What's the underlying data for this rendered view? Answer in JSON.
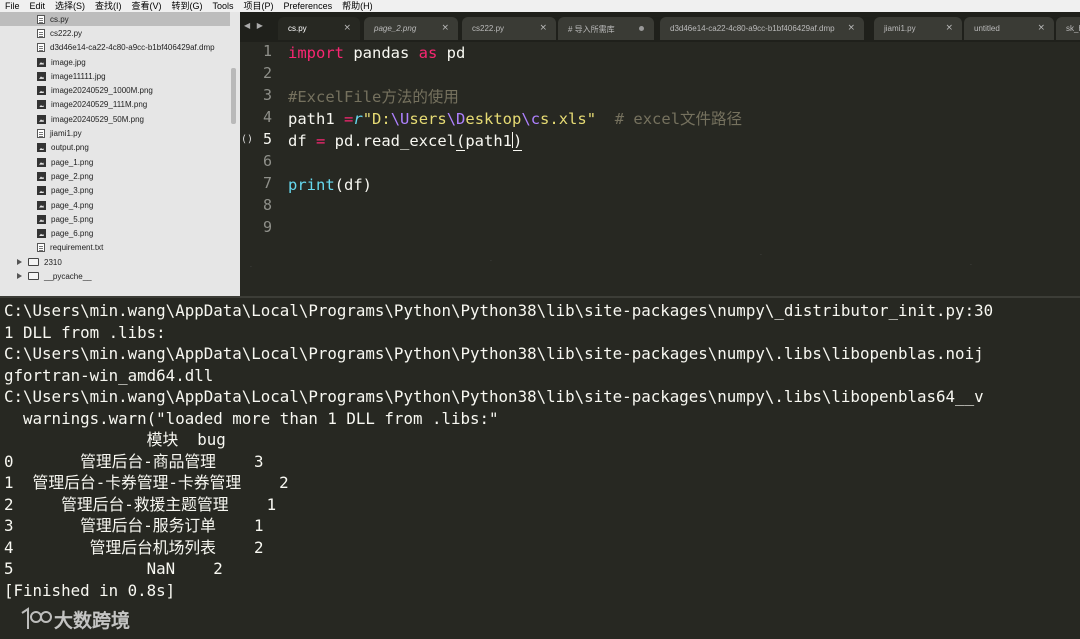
{
  "menubar": {
    "items": [
      "File",
      "Edit",
      "选择(S)",
      "查找(I)",
      "查看(V)",
      "转到(G)",
      "Tools",
      "项目(P)",
      "Preferences",
      "帮助(H)"
    ]
  },
  "sidebar": {
    "files": [
      {
        "name": "cs.py",
        "icon": "doc",
        "selected": true
      },
      {
        "name": "cs222.py",
        "icon": "doc"
      },
      {
        "name": "d3d46e14-ca22-4c80-a9cc-b1bf406429af.dmp",
        "icon": "doc"
      },
      {
        "name": "image.jpg",
        "icon": "img"
      },
      {
        "name": "image11111.jpg",
        "icon": "img"
      },
      {
        "name": "image20240529_1000M.png",
        "icon": "img"
      },
      {
        "name": "image20240529_111M.png",
        "icon": "img"
      },
      {
        "name": "image20240529_50M.png",
        "icon": "img"
      },
      {
        "name": "jiami1.py",
        "icon": "doc"
      },
      {
        "name": "output.png",
        "icon": "img"
      },
      {
        "name": "page_1.png",
        "icon": "img"
      },
      {
        "name": "page_2.png",
        "icon": "img"
      },
      {
        "name": "page_3.png",
        "icon": "img"
      },
      {
        "name": "page_4.png",
        "icon": "img"
      },
      {
        "name": "page_5.png",
        "icon": "img"
      },
      {
        "name": "page_6.png",
        "icon": "img"
      },
      {
        "name": "requirement.txt",
        "icon": "doc"
      }
    ],
    "folders": [
      {
        "name": "2310"
      },
      {
        "name": "__pycache__"
      }
    ]
  },
  "tabs": [
    {
      "label": "cs.py",
      "active": true,
      "close": "×"
    },
    {
      "label": "page_2.png",
      "italic": true,
      "close": "×"
    },
    {
      "label": "cs222.py",
      "close": "×"
    },
    {
      "label": "# 导入所需库",
      "dirty": true
    },
    {
      "label": "d3d46e14-ca22-4c80-a9cc-b1bf406429af.dmp",
      "close": "×"
    },
    {
      "label": "jiami1.py",
      "close": "×"
    },
    {
      "label": "untitled",
      "close": "×"
    },
    {
      "label": "sk_h"
    }
  ],
  "editor": {
    "line_numbers": [
      "1",
      "2",
      "3",
      "4",
      "5",
      "6",
      "7",
      "8",
      "9"
    ],
    "current_line": "5",
    "fold_marker": "()",
    "code": {
      "l1": {
        "kw_import": "import",
        "mod": " pandas ",
        "kw_as": "as",
        "alias": " pd"
      },
      "l3": {
        "comment": "#ExcelFile方法的使用"
      },
      "l4": {
        "var": "path1 ",
        "op": "=",
        "prefix": "r",
        "q1": "\"D:",
        "e1": "\\U",
        "s1": "sers",
        "e2": "\\D",
        "s2": "esktop",
        "e3": "\\c",
        "s3": "s.xls\"",
        "pad": "  ",
        "comment": "# excel文件路径"
      },
      "l5": {
        "a": "df ",
        "op": "=",
        "b": " pd.read_excel",
        "p_open": "(",
        "arg": "path1",
        "p_close": ")"
      },
      "l7": {
        "fn": "print",
        "rest": "(df)"
      }
    }
  },
  "console": {
    "lines": [
      "C:\\Users\\min.wang\\AppData\\Local\\Programs\\Python\\Python38\\lib\\site-packages\\numpy\\_distributor_init.py:30",
      "1 DLL from .libs:",
      "C:\\Users\\min.wang\\AppData\\Local\\Programs\\Python\\Python38\\lib\\site-packages\\numpy\\.libs\\libopenblas.noij",
      "gfortran-win_amd64.dll",
      "C:\\Users\\min.wang\\AppData\\Local\\Programs\\Python\\Python38\\lib\\site-packages\\numpy\\.libs\\libopenblas64__v",
      "  warnings.warn(\"loaded more than 1 DLL from .libs:\"",
      "               模块  bug",
      "0       管理后台-商品管理    3",
      "1  管理后台-卡券管理-卡券管理    2",
      "2     管理后台-救援主题管理    1",
      "3       管理后台-服务订单    1",
      "4        管理后台机场列表    2",
      "5              NaN    2",
      "[Finished in 0.8s]"
    ]
  },
  "watermark": {
    "text": "大数跨境"
  }
}
